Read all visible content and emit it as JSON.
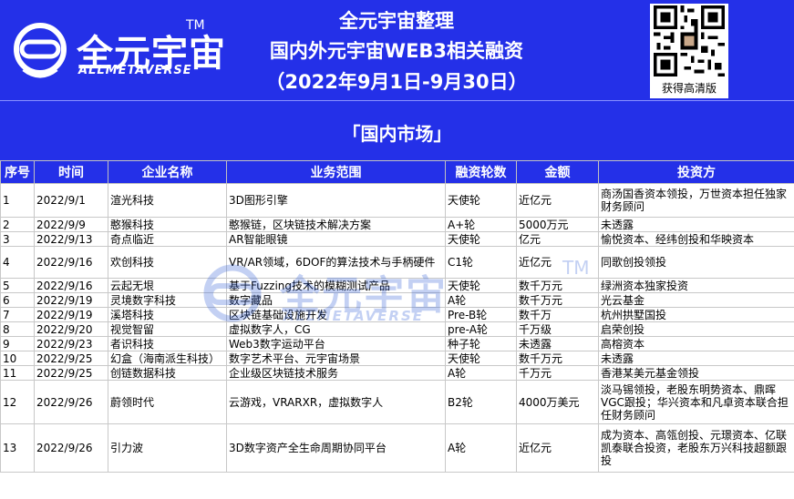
{
  "header": {
    "logo_text": "全元宇宙",
    "logo_tm": "TM",
    "logo_sub": "ALLMETAVERSE",
    "title_line1": "全元宇宙整理",
    "title_line2": "国内外元宇宙WEB3相关融资",
    "title_line3": "（2022年9月1日-9月30日）",
    "qr_caption": "获得高清版"
  },
  "section_title": "「国内市场」",
  "table": {
    "headers": [
      "序号",
      "时间",
      "企业名称",
      "业务范围",
      "融资轮数",
      "金额",
      "投资方"
    ],
    "rows": [
      [
        "1",
        "2022/9/1",
        "渲光科技",
        "3D图形引擎",
        "天使轮",
        "近亿元",
        "商汤国香资本领投，万世资本担任独家财务顾问"
      ],
      [
        "2",
        "2022/9/9",
        "憨猴科技",
        "憨猴链，区块链技术解决方案",
        "A+轮",
        "5000万元",
        "未透露"
      ],
      [
        "3",
        "2022/9/13",
        "奇点临近",
        "AR智能眼镜",
        "天使轮",
        "亿元",
        "愉悦资本、经纬创投和华映资本"
      ],
      [
        "4",
        "2022/9/16",
        "欢创科技",
        "VR/AR领域，6DOF的算法技术与手柄硬件",
        "C1轮",
        "近亿元",
        "同歌创投领投"
      ],
      [
        "5",
        "2022/9/16",
        "云起无垠",
        "基于Fuzzing技术的模糊测试产品",
        "天使轮",
        "数千万元",
        "绿洲资本独家投资"
      ],
      [
        "6",
        "2022/9/19",
        "灵境数字科技",
        "数字藏品",
        "A轮",
        "数千万元",
        "光云基金"
      ],
      [
        "7",
        "2022/9/19",
        "溪塔科技",
        "区块链基础设施开发",
        "Pre-B轮",
        "数千万",
        "杭州拱墅国投"
      ],
      [
        "8",
        "2022/9/20",
        "视觉智留",
        "虚拟数字人，CG",
        "pre-A轮",
        "千万级",
        "启荣创投"
      ],
      [
        "9",
        "2022/9/23",
        "者识科技",
        "Web3数字运动平台",
        "种子轮",
        "未透露",
        "高榕资本"
      ],
      [
        "10",
        "2022/9/25",
        "幻盒（海南派生科技）",
        "数字艺术平台、元宇宙场景",
        "天使轮",
        "数千万元",
        "未透露"
      ],
      [
        "11",
        "2022/9/25",
        "创链数据科技",
        "企业级区块链技术服务",
        "A轮",
        "千万元",
        "香港某美元基金领投"
      ],
      [
        "12",
        "2022/9/26",
        "蔚领时代",
        "云游戏，VRARXR，虚拟数字人",
        "B2轮",
        "4000万美元",
        "淡马锡领投，老股东明势资本、鼎晖VGC跟投；华兴资本和凡卓资本联合担任财务顾问"
      ],
      [
        "13",
        "2022/9/26",
        "引力波",
        "3D数字资产全生命周期协同平台",
        "A轮",
        "近亿元",
        "成为资本、高瓴创投、元璟资本、亿联凯泰联合投资，老股东万兴科技超额跟投"
      ]
    ]
  },
  "watermark": {
    "text": "全元宇宙",
    "sub": "ALLMETAVERSE",
    "tm": "TM"
  },
  "colors": {
    "banner_blue": "#2430e8",
    "watermark_blue": "#2a5bd7"
  }
}
